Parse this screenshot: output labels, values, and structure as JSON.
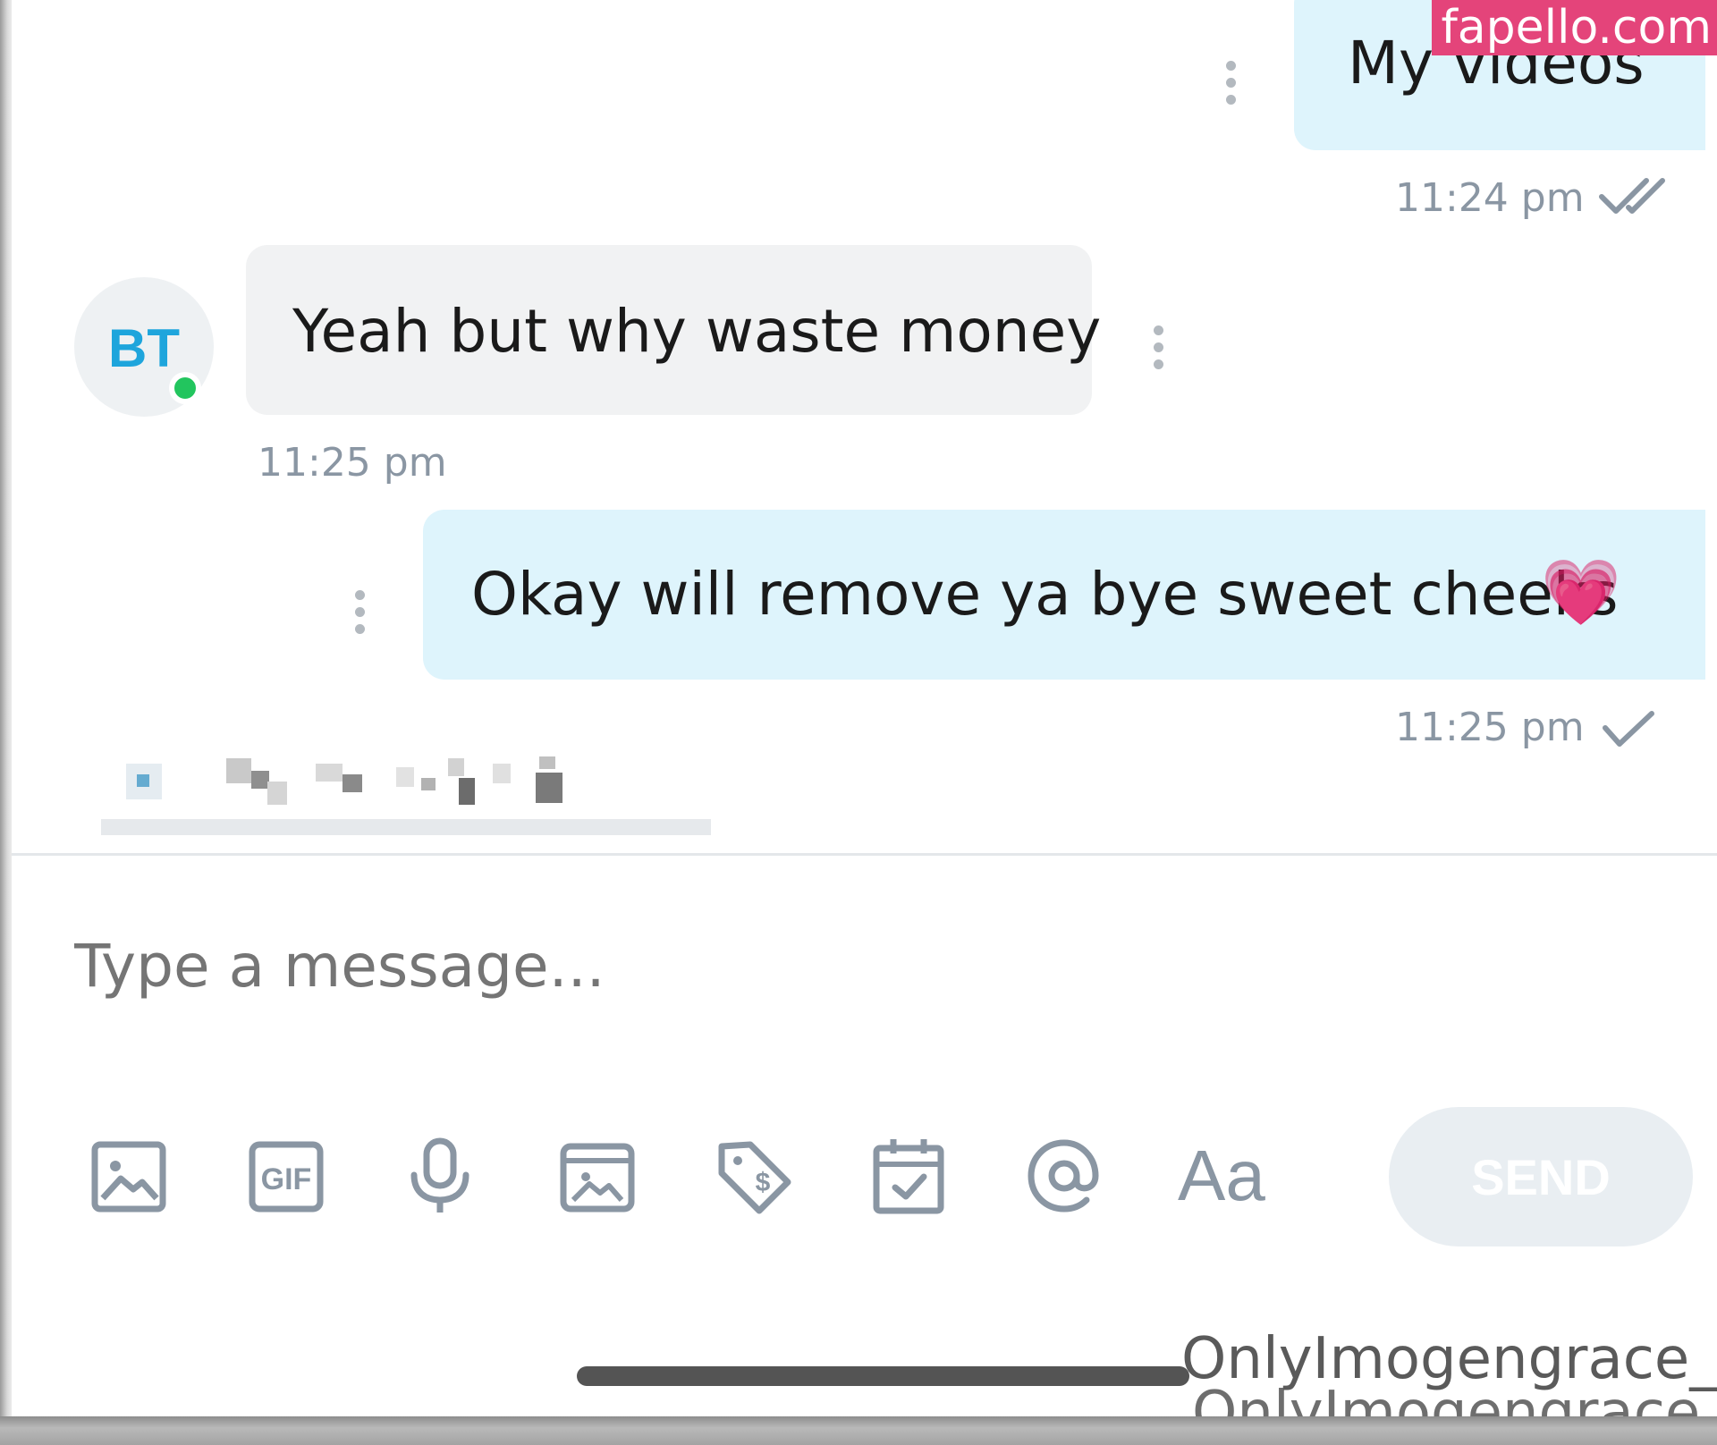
{
  "brand": {
    "text": "fapello.com",
    "color": "#e4447a"
  },
  "colors": {
    "outgoing_bubble": "#def4fc",
    "incoming_bubble": "#f1f2f3",
    "accent": "#1ea5dc",
    "online": "#22c55e",
    "muted": "#8a96a3"
  },
  "messages": [
    {
      "direction": "outgoing",
      "text": "My videos",
      "time": "11:24 pm",
      "status_icon": "double-check-icon"
    },
    {
      "direction": "incoming",
      "sender_initials": "BT",
      "online": true,
      "text": "Yeah but why waste money",
      "time": "11:25 pm"
    },
    {
      "direction": "outgoing",
      "text": "Okay will remove ya bye sweet cheeks",
      "emoji": "💗",
      "time": "11:25 pm",
      "status_icon": "single-check-icon"
    }
  ],
  "composer": {
    "placeholder": "Type a message...",
    "tools": [
      "image-icon",
      "gif-icon",
      "microphone-icon",
      "media-vault-icon",
      "price-tag-icon",
      "schedule-icon",
      "mention-icon",
      "text-format-icon"
    ],
    "format_label": "Aa",
    "gif_label": "GIF",
    "send_label": "SEND"
  },
  "watermark": "OnlyImogengrace_x"
}
